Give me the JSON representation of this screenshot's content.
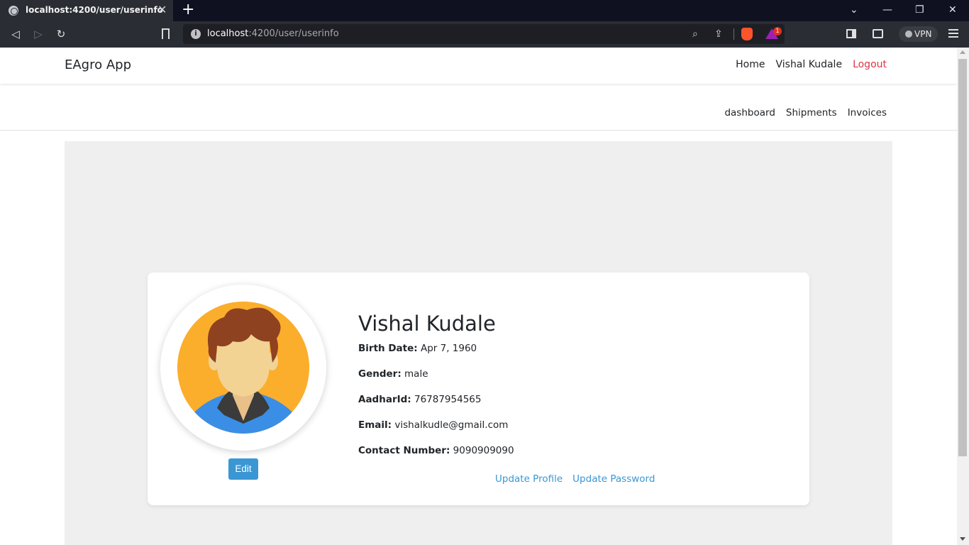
{
  "browser": {
    "tab_title": "localhost:4200/user/userinfo",
    "url_host": "localhost",
    "url_path": ":4200/user/userinfo",
    "vpn_label": "VPN",
    "rewards_badge": "1"
  },
  "navbar": {
    "brand": "EAgro App",
    "links": [
      "Home",
      "Vishal Kudale",
      "Logout"
    ]
  },
  "subnav": {
    "links": [
      "dashboard",
      "Shipments",
      "Invoices"
    ]
  },
  "profile": {
    "name": "Vishal Kudale",
    "fields": [
      {
        "label": "Birth Date:",
        "value": "Apr 7, 1960"
      },
      {
        "label": "Gender:",
        "value": "male"
      },
      {
        "label": "AadharId:",
        "value": "76787954565"
      },
      {
        "label": "Email:",
        "value": "vishalkudle@gmail.com"
      },
      {
        "label": "Contact Number:",
        "value": "9090909090"
      }
    ],
    "edit_label": "Edit",
    "update_profile_label": "Update Profile",
    "update_password_label": "Update Password"
  },
  "colors": {
    "accent": "#3a97d4",
    "logout": "#dc3545",
    "content_bg": "#efefef",
    "avatar_bg": "#fbae2c"
  }
}
